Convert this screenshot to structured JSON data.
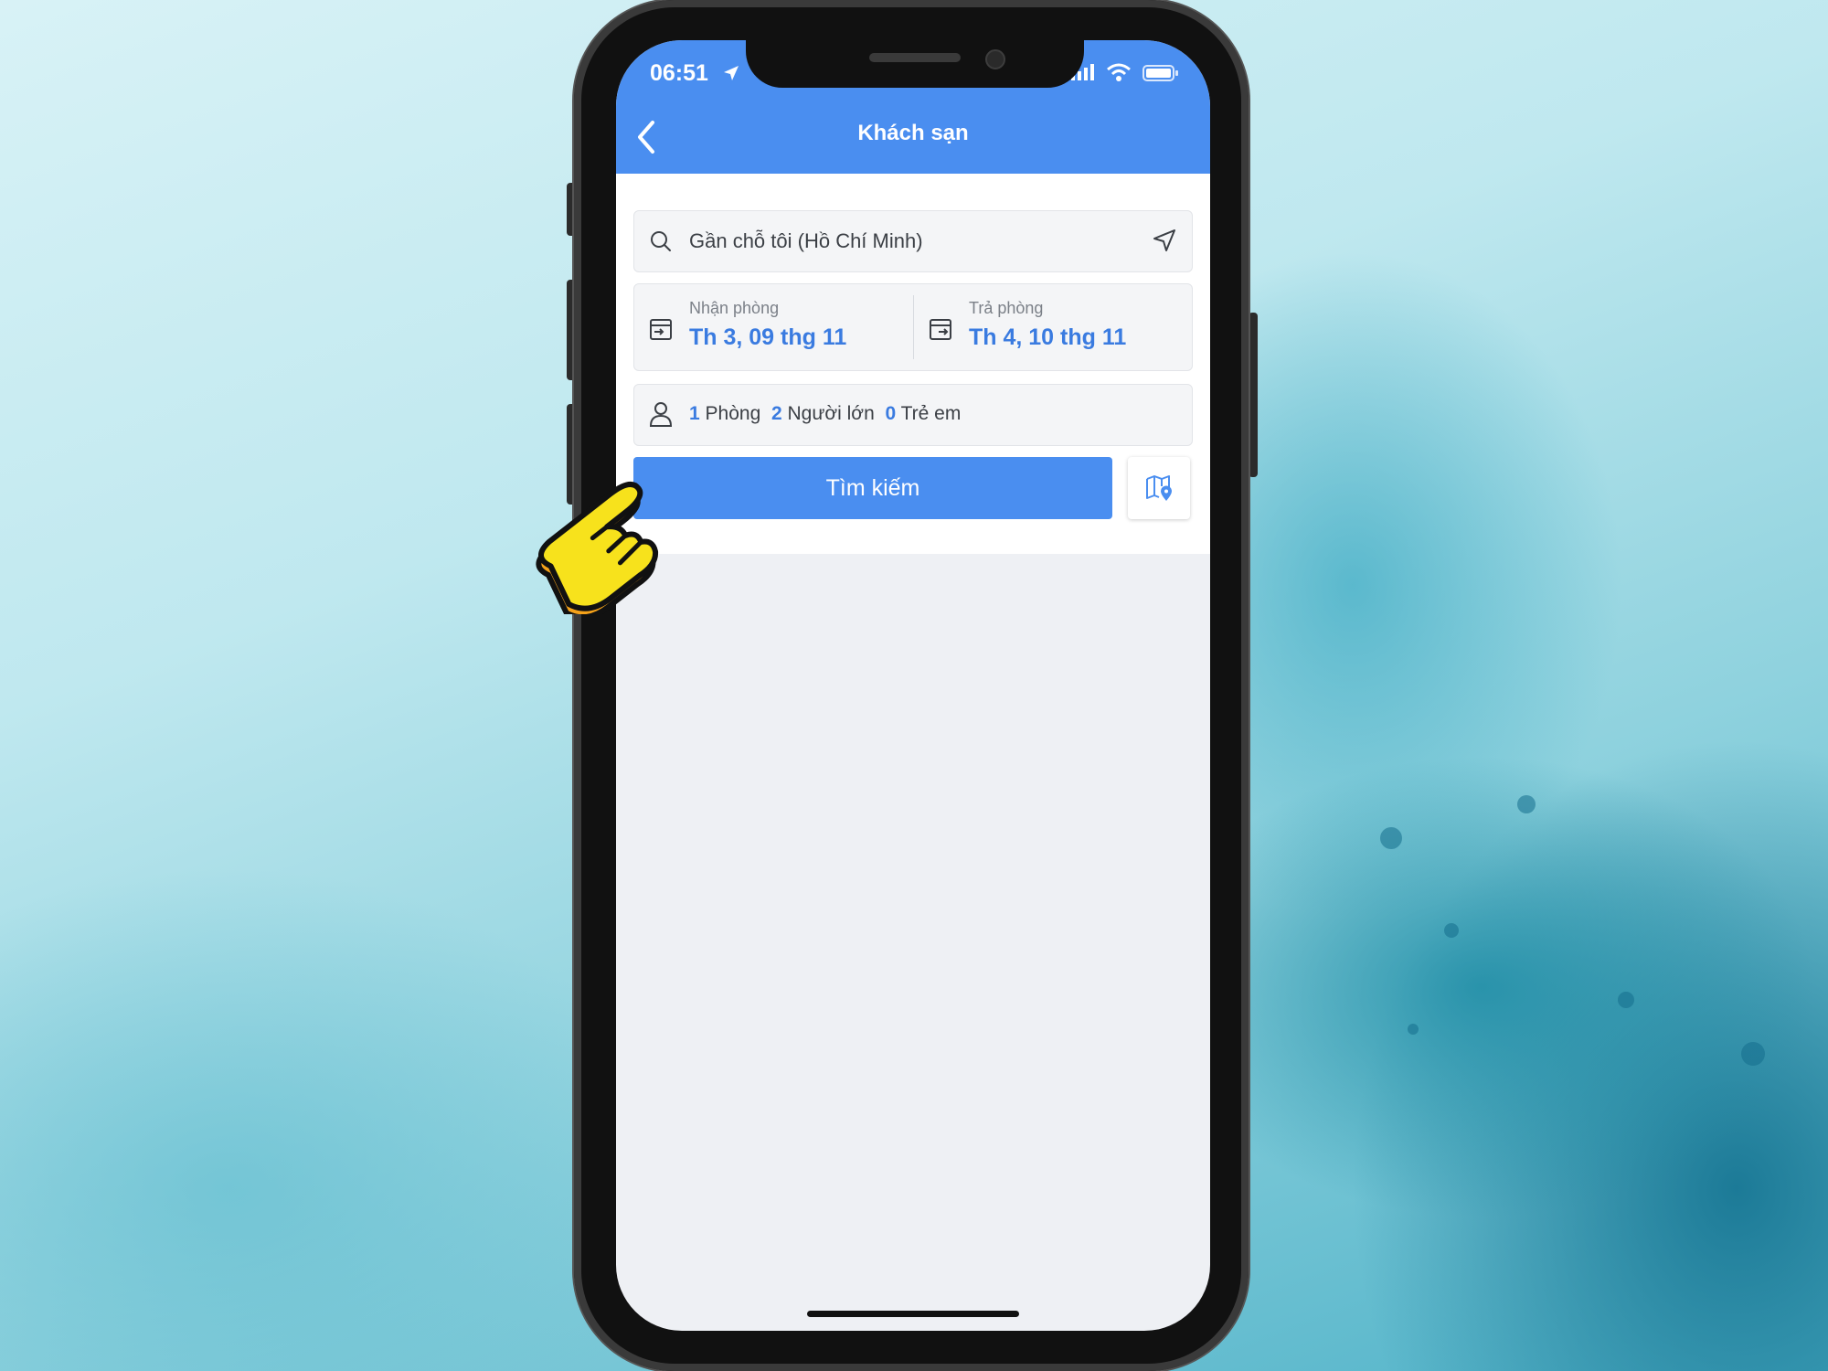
{
  "status_bar": {
    "time": "06:51"
  },
  "header": {
    "title": "Khách sạn"
  },
  "search": {
    "value": "Gần chỗ tôi (Hồ Chí Minh)"
  },
  "checkin": {
    "label": "Nhận phòng",
    "value": "Th 3, 09 thg 11"
  },
  "checkout": {
    "label": "Trả phòng",
    "value": "Th 4, 10 thg 11"
  },
  "guests": {
    "rooms_count": "1",
    "rooms_label": "Phòng",
    "adults_count": "2",
    "adults_label": "Người lớn",
    "children_count": "0",
    "children_label": "Trẻ em"
  },
  "actions": {
    "search_label": "Tìm kiếm"
  },
  "icons": {
    "back": "chevron-left-icon",
    "search": "search-icon",
    "navigate": "navigation-arrow-icon",
    "checkin": "calendar-checkin-icon",
    "checkout": "calendar-checkout-icon",
    "guests": "person-icon",
    "map": "map-pin-icon",
    "pointer": "pointing-hand-icon"
  },
  "colors": {
    "accent": "#4a8ef0",
    "accent_text": "#3a7be0",
    "pointer": "#f7e21c"
  }
}
